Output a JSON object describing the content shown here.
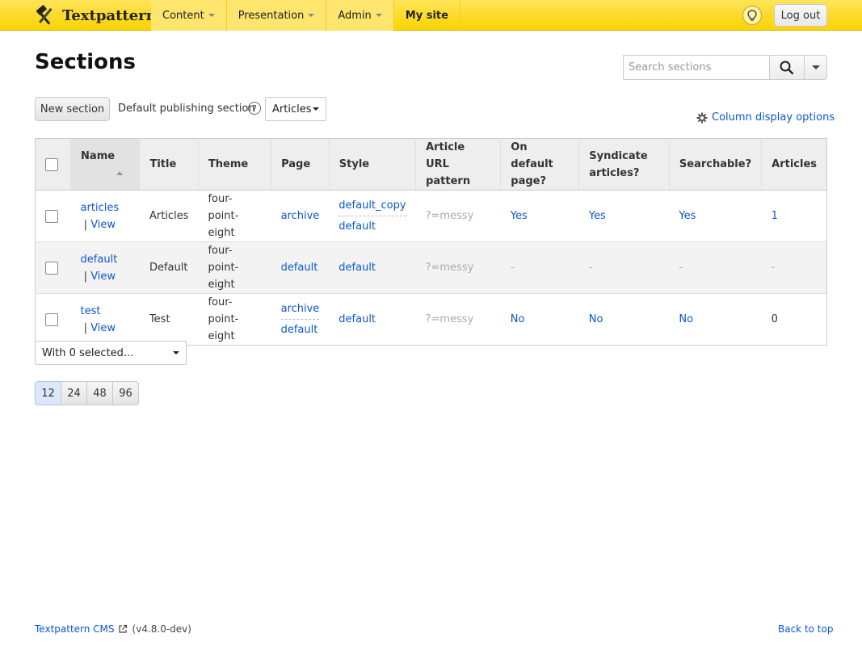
{
  "header": {
    "brand": "Textpattern",
    "nav": [
      {
        "label": "Content"
      },
      {
        "label": "Presentation"
      },
      {
        "label": "Admin"
      },
      {
        "label": "My site"
      }
    ],
    "logout_label": "Log out",
    "accent": "#fbd300"
  },
  "page": {
    "title": "Sections",
    "search_placeholder": "Search sections",
    "new_section_label": "New section",
    "default_publishing_label": "Default publishing section",
    "help_glyph": "?",
    "default_publishing_value": "Articles",
    "column_options_label": "Column display options"
  },
  "table": {
    "headers": {
      "name": "Name",
      "title": "Title",
      "theme": "Theme",
      "page": "Page",
      "style": "Style",
      "url_pattern": "Article URL pattern",
      "on_default": "On default page?",
      "syndicate": "Syndicate articles?",
      "searchable": "Searchable?",
      "articles": "Articles"
    },
    "rows": [
      {
        "name": "articles",
        "view": "View",
        "title": "Articles",
        "theme": "four-point-eight",
        "page": "archive",
        "style_top": "default_copy",
        "style_bottom": "default",
        "url": "?=messy",
        "on_default": "Yes",
        "syndicate": "Yes",
        "searchable": "Yes",
        "articles": "1"
      },
      {
        "name": "default",
        "view": "View",
        "title": "Default",
        "theme": "four-point-eight",
        "page": "default",
        "style": "default",
        "url": "?=messy",
        "on_default": "-",
        "syndicate": "-",
        "searchable": "-",
        "articles": "-"
      },
      {
        "name": "test",
        "view": "View",
        "title": "Test",
        "theme": "four-point-eight",
        "page_top": "archive",
        "page_bottom": "default",
        "style": "default",
        "url": "?=messy",
        "on_default": "No",
        "syndicate": "No",
        "searchable": "No",
        "articles": "0"
      }
    ]
  },
  "multi_edit": {
    "label": "With 0 selected..."
  },
  "pager": [
    "12",
    "24",
    "48",
    "96"
  ],
  "footer": {
    "cms_label": "Textpattern CMS",
    "version": "(v4.8.0-dev)",
    "back_to_top": "Back to top"
  }
}
